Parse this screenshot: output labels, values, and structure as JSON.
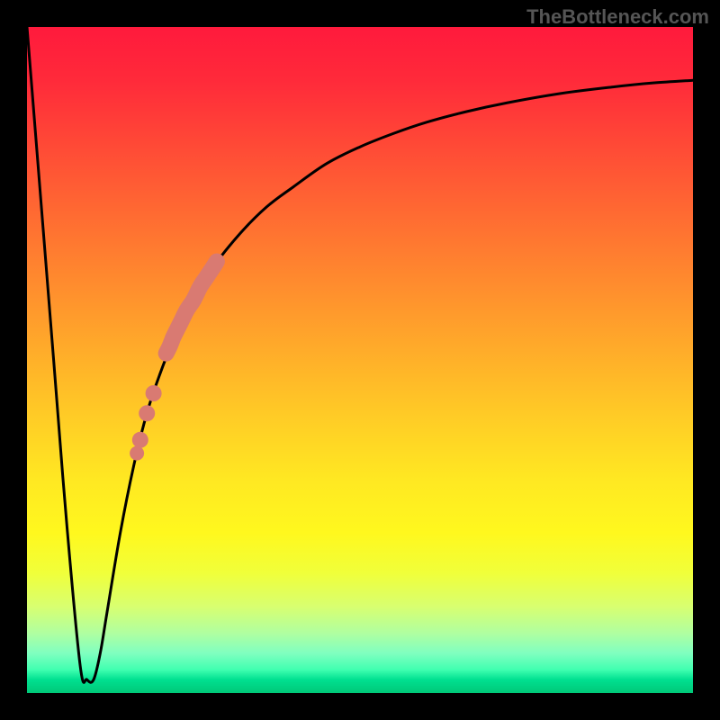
{
  "watermark": "TheBottleneck.com",
  "chart_data": {
    "type": "line",
    "title": "",
    "xlabel": "",
    "ylabel": "",
    "xlim": [
      0,
      100
    ],
    "ylim": [
      0,
      100
    ],
    "series": [
      {
        "name": "bottleneck-curve",
        "x": [
          0,
          2,
          4,
          6,
          8,
          9,
          10,
          11,
          12,
          14,
          16,
          18,
          20,
          22,
          25,
          28,
          32,
          36,
          40,
          45,
          50,
          55,
          60,
          66,
          72,
          80,
          88,
          94,
          100
        ],
        "values": [
          100,
          75,
          50,
          25,
          4,
          2,
          2,
          6,
          12,
          24,
          34,
          42,
          48,
          53,
          59,
          64,
          69,
          73,
          76,
          79.5,
          82,
          84,
          85.7,
          87.3,
          88.6,
          90,
          91,
          91.6,
          92
        ]
      },
      {
        "name": "highlight-segment",
        "x": [
          16.5,
          17,
          18,
          19,
          20,
          20.7,
          20.9,
          21.4,
          21.8,
          22,
          23,
          24,
          25,
          26,
          27,
          28,
          28.5
        ],
        "values": [
          36,
          38,
          42,
          45,
          48,
          50,
          51,
          52,
          53,
          53.5,
          55.5,
          57.5,
          59,
          61,
          62.5,
          64,
          64.8
        ]
      }
    ],
    "gradient_stops": [
      {
        "pos": 0.0,
        "color": "#ff1a3c"
      },
      {
        "pos": 0.18,
        "color": "#ff4a36"
      },
      {
        "pos": 0.38,
        "color": "#ff8a2e"
      },
      {
        "pos": 0.58,
        "color": "#ffca26"
      },
      {
        "pos": 0.76,
        "color": "#fff81e"
      },
      {
        "pos": 0.91,
        "color": "#b0ffa0"
      },
      {
        "pos": 1.0,
        "color": "#00c878"
      }
    ]
  }
}
